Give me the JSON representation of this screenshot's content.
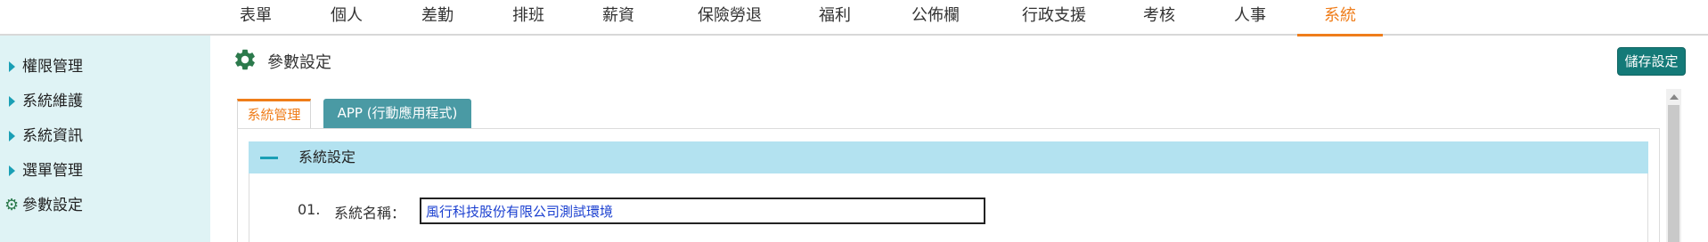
{
  "topnav": {
    "items": [
      {
        "label": "表單"
      },
      {
        "label": "個人"
      },
      {
        "label": "差勤"
      },
      {
        "label": "排班"
      },
      {
        "label": "薪資"
      },
      {
        "label": "保險勞退"
      },
      {
        "label": "福利"
      },
      {
        "label": "公佈欄"
      },
      {
        "label": "行政支援"
      },
      {
        "label": "考核"
      },
      {
        "label": "人事"
      },
      {
        "label": "系統"
      }
    ],
    "active": "系統"
  },
  "sidebar": {
    "items": [
      {
        "label": "權限管理",
        "icon": "caret-right-icon"
      },
      {
        "label": "系統維護",
        "icon": "caret-right-icon"
      },
      {
        "label": "系統資訊",
        "icon": "caret-right-icon"
      },
      {
        "label": "選單管理",
        "icon": "caret-right-icon"
      },
      {
        "label": "參數設定",
        "icon": "gear-icon"
      }
    ],
    "active": "參數設定"
  },
  "header": {
    "title": "參數設定",
    "save_label": "儲存設定"
  },
  "tabs": [
    {
      "label": "系統管理",
      "active": true
    },
    {
      "label": "APP (行動應用程式)",
      "active": false
    }
  ],
  "section": {
    "title": "系統設定",
    "fields": [
      {
        "no": "01.",
        "label": "系統名稱：",
        "value": "風行科技股份有限公司測試環境"
      }
    ]
  },
  "colors": {
    "accent": "#ef7d1a",
    "brand_teal": "#147a78",
    "sidebar_bg": "#dff3f5",
    "section_bg": "#b3e2f0",
    "tab_inactive": "#4a9aa4"
  }
}
